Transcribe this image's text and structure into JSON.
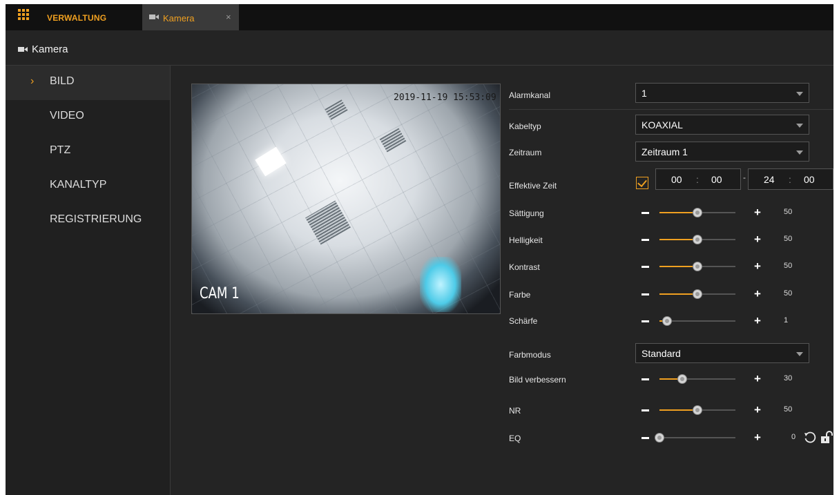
{
  "topbar": {
    "brand": "VERWALTUNG",
    "tab_label": "Kamera",
    "tab_close": "×"
  },
  "page": {
    "title": "Kamera"
  },
  "sidebar": {
    "active_marker": "›",
    "items": [
      {
        "label": "BILD",
        "active": true
      },
      {
        "label": "VIDEO"
      },
      {
        "label": "PTZ"
      },
      {
        "label": "KANALTYP"
      },
      {
        "label": "REGISTRIERUNG"
      }
    ]
  },
  "preview": {
    "timestamp": "2019-11-19 15:53:09",
    "camera_label": "CAM 1"
  },
  "settings": {
    "alarmkanal": {
      "label": "Alarmkanal",
      "value": "1"
    },
    "kabeltyp": {
      "label": "Kabeltyp",
      "value": "KOAXIAL"
    },
    "zeitraum": {
      "label": "Zeitraum",
      "value": "Zeitraum 1"
    },
    "effektive_zeit": {
      "label": "Effektive Zeit",
      "checked": true,
      "start_h": "00",
      "start_m": "00",
      "end_h": "24",
      "end_m": "00",
      "colon": ":",
      "dash": "-"
    },
    "saettigung": {
      "label": "Sättigung",
      "value": "50",
      "fraction": 0.5
    },
    "helligkeit": {
      "label": "Helligkeit",
      "value": "50",
      "fraction": 0.5
    },
    "kontrast": {
      "label": "Kontrast",
      "value": "50",
      "fraction": 0.5
    },
    "farbe": {
      "label": "Farbe",
      "value": "50",
      "fraction": 0.5
    },
    "schaerfe": {
      "label": "Schärfe",
      "value": "1",
      "fraction": 0.1
    },
    "farbmodus": {
      "label": "Farbmodus",
      "value": "Standard"
    },
    "bild_verbessern": {
      "label": "Bild verbessern",
      "value": "30",
      "fraction": 0.3
    },
    "nr": {
      "label": "NR",
      "value": "50",
      "fraction": 0.5
    },
    "eq": {
      "label": "EQ",
      "value": "0",
      "fraction": 0.0
    }
  },
  "colors": {
    "accent": "#f0a020",
    "background": "#242424",
    "sidebar": "#202020",
    "topbar": "#111111"
  },
  "icons": {
    "logo": "grid-icon",
    "camera": "video-camera-icon",
    "reset": "reset-icon",
    "lock": "unlock-icon"
  }
}
